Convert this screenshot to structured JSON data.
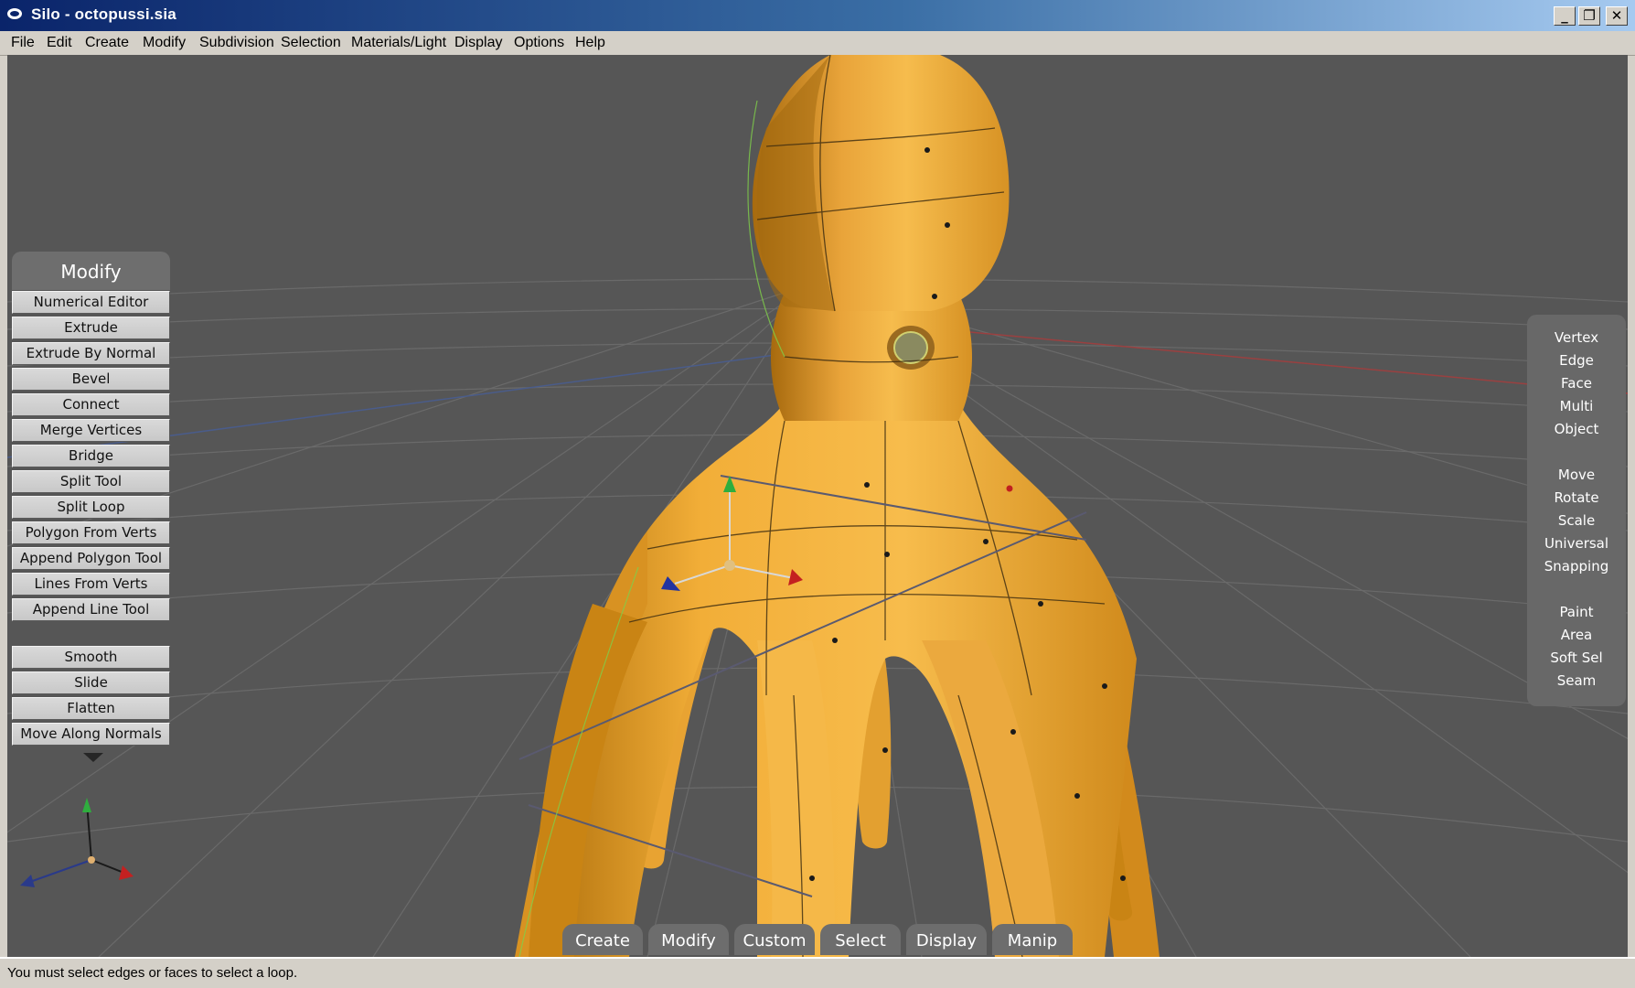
{
  "window": {
    "title": "Silo  - octopussi.sia",
    "minimize_glyph": "_",
    "restore_glyph": "❐",
    "close_glyph": "✕"
  },
  "menubar": [
    "File",
    "Edit",
    "Create",
    "Modify",
    "Subdivision",
    "Selection",
    "Materials/Light",
    "Display",
    "Options",
    "Help"
  ],
  "left_panel": {
    "title": "Modify",
    "tools": [
      "Numerical Editor",
      "Extrude",
      "Extrude By Normal",
      "Bevel",
      "Connect",
      "Merge Vertices",
      "Bridge",
      "Split Tool",
      "Split Loop",
      "Polygon From Verts",
      "Append Polygon Tool",
      "Lines From Verts",
      "Append Line Tool"
    ],
    "tools2": [
      "Smooth",
      "Slide",
      "Flatten",
      "Move Along Normals"
    ]
  },
  "right_panel": {
    "selection_modes": [
      "Vertex",
      "Edge",
      "Face",
      "Multi",
      "Object"
    ],
    "manipulators": [
      "Move",
      "Rotate",
      "Scale",
      "Universal",
      "Snapping"
    ],
    "extras": [
      "Paint",
      "Area",
      "Soft Sel",
      "Seam"
    ]
  },
  "bottom_tabs": [
    "Create",
    "Modify",
    "Custom",
    "Select",
    "Display",
    "Manip"
  ],
  "status": {
    "message": "You must select edges or faces to select a loop."
  },
  "colors": {
    "viewport_bg": "#565656",
    "model": "#f0ac35",
    "model_shadow": "#c98414",
    "axis_x": "#d02020",
    "axis_y": "#20b040",
    "axis_z": "#2040b0",
    "selection_edge": "#7fd04a"
  }
}
